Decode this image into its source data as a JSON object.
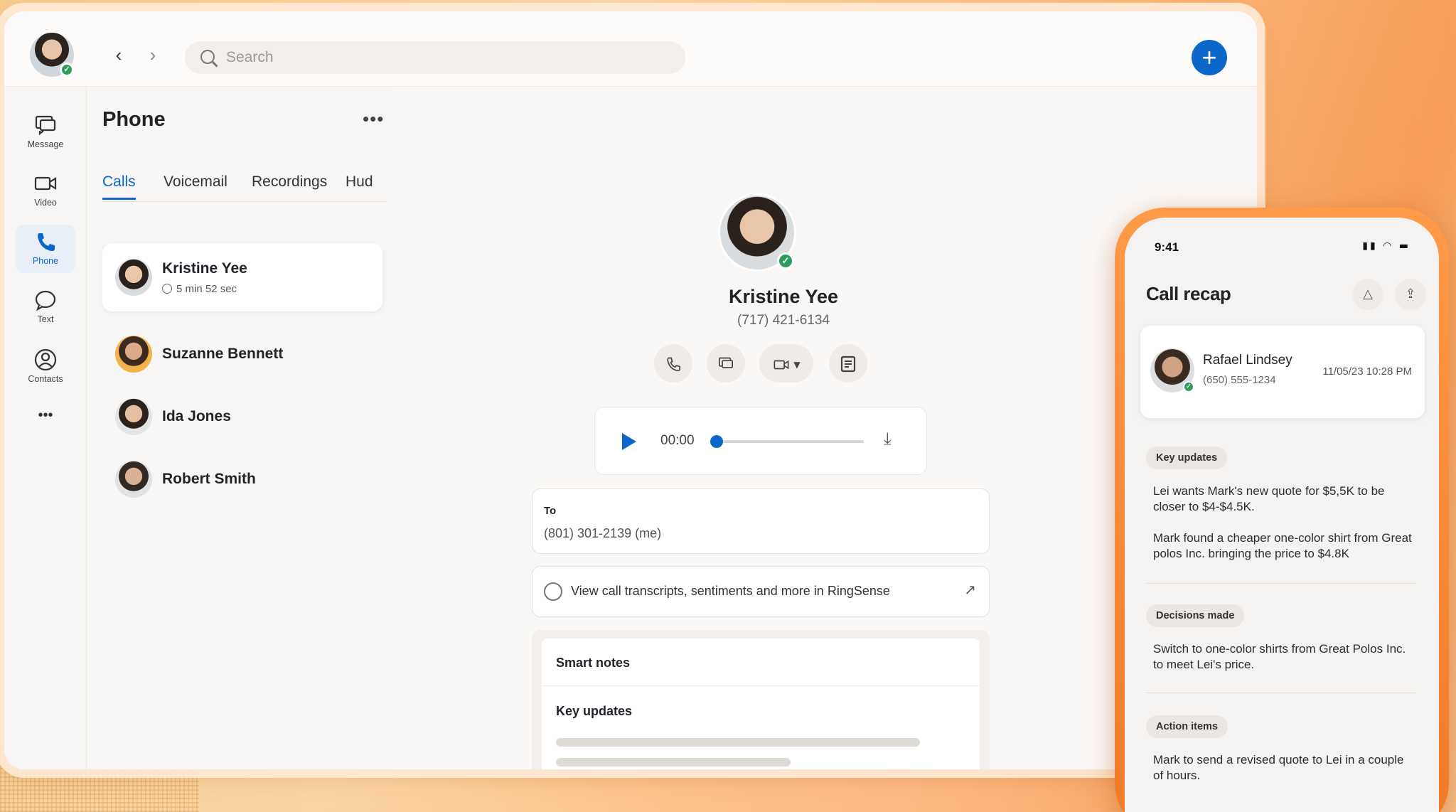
{
  "topbar": {
    "search_placeholder": "Search",
    "back_icon": "chevron-left-icon",
    "forward_icon": "chevron-right-icon",
    "add_label": "+"
  },
  "leftnav": {
    "items": [
      {
        "label": "Message",
        "icon": "message-icon"
      },
      {
        "label": "Video",
        "icon": "video-icon"
      },
      {
        "label": "Phone",
        "icon": "phone-icon",
        "active": true
      },
      {
        "label": "Text",
        "icon": "text-bubble-icon"
      },
      {
        "label": "Contacts",
        "icon": "contacts-icon"
      }
    ],
    "more": "•••"
  },
  "list": {
    "title": "Phone",
    "more": "•••",
    "tabs": [
      {
        "label": "Calls",
        "active": true
      },
      {
        "label": "Voicemail"
      },
      {
        "label": "Recordings"
      },
      {
        "label": "Hud"
      }
    ],
    "calls": [
      {
        "name": "Kristine Yee",
        "duration": "5 min 52 sec",
        "selected": true
      },
      {
        "name": "Suzanne Bennett"
      },
      {
        "name": "Ida Jones"
      },
      {
        "name": "Robert Smith"
      }
    ]
  },
  "detail": {
    "name": "Kristine Yee",
    "phone": "(717) 421-6134",
    "player_time": "00:00",
    "player_progress": 0,
    "to_label": "To",
    "to_value": "(801) 301-2139 (me)",
    "ringsense_text": "View call transcripts, sentiments and more in RingSense",
    "smart_notes": "Smart notes",
    "key_updates": "Key updates"
  },
  "phone": {
    "time": "9:41",
    "title": "Call recap",
    "caller_name": "Rafael Lindsey",
    "caller_phone": "(650) 555-1234",
    "caller_datetime": "11/05/23 10:28 PM",
    "sections": {
      "key_updates_label": "Key updates",
      "key_update_1": "Lei wants Mark's new quote for $5,5K to be closer to $4-$4.5K.",
      "key_update_2": "Mark found a cheaper one-color shirt from Great polos Inc. bringing the price to $4.8K",
      "decisions_label": "Decisions made",
      "decision_1": "Switch to one-color shirts from Great Polos Inc. to meet Lei's price.",
      "actions_label": "Action items",
      "action_1": "Mark to send a revised quote to Lei in a couple of hours."
    }
  },
  "colors": {
    "accent": "#0b67c9",
    "presence": "#2f9d5a",
    "phone_frame": "#f07a28"
  }
}
